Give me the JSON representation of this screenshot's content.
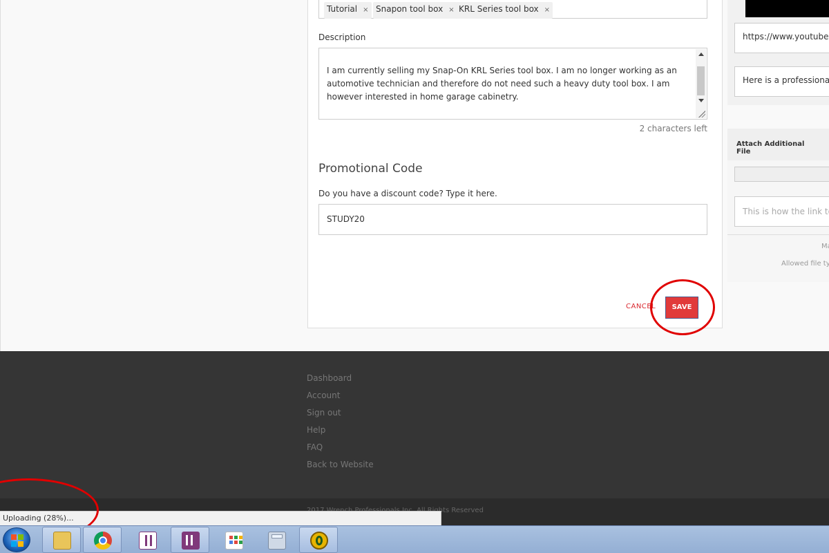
{
  "tags": [
    {
      "label": "Tutorial",
      "remove": "×"
    },
    {
      "label": "Snapon tool box",
      "remove": "×"
    },
    {
      "label": "KRL Series tool box",
      "remove": "×"
    }
  ],
  "description": {
    "label": "Description",
    "text": "I am currently selling my Snap-On KRL Series tool box. I am no longer working as an automotive technician and therefore do not need such a heavy duty tool box. I am however interested in home garage cabinetry.",
    "char_count": "2 characters left"
  },
  "promo": {
    "title": "Promotional Code",
    "prompt": "Do you have a discount code? Type it here.",
    "value": "STUDY20"
  },
  "actions": {
    "cancel_label": "CANCEL",
    "save_label": "SAVE"
  },
  "side_panel": {
    "video_url": "https://www.youtube.c",
    "video_desc": "Here is a professional r",
    "attach_title": "Attach Additional File",
    "attach_placeholder": "This is how the link to c",
    "note_max": "Ma",
    "note_allowed": "Allowed file typ"
  },
  "footer": {
    "links": [
      "Dashboard",
      "Account",
      "Sign out",
      "Help",
      "FAQ",
      "Back to Website"
    ],
    "copyright": "2017 Wrench Professionals Inc. All Rights Reserved"
  },
  "status_bar": {
    "text": "Uploading (28%)..."
  },
  "taskbar": {
    "apps": [
      "windows-explorer",
      "google-chrome",
      "onenote-notebook",
      "onenote",
      "apps-grid",
      "calculator",
      "slide-app"
    ]
  },
  "colors": {
    "accent": "#e13a3a",
    "footer_bg": "#353535",
    "annotation": "#e00000"
  }
}
